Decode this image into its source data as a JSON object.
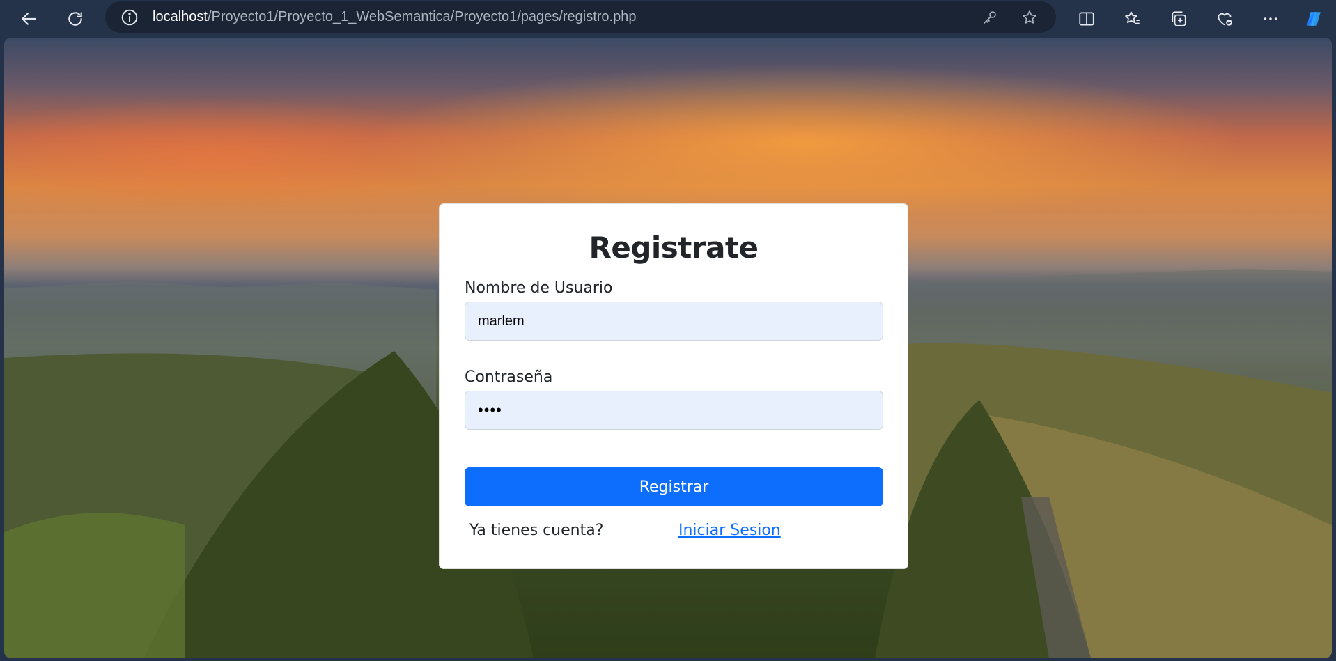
{
  "browser": {
    "url_host": "localhost",
    "url_path": "/Proyecto1/Proyecto_1_WebSemantica/Proyecto1/pages/registro.php",
    "icons": [
      "back-icon",
      "refresh-icon",
      "info-icon",
      "key-icon",
      "star-icon",
      "split-screen-icon",
      "favorites-icon",
      "collections-icon",
      "browser-essentials-icon",
      "more-icon",
      "copilot-icon"
    ]
  },
  "form": {
    "title": "Registrate",
    "username_label": "Nombre de Usuario",
    "username_value": "marlem",
    "password_label": "Contraseña",
    "password_value": "••••",
    "submit_label": "Registrar",
    "have_account_text": "Ya tienes cuenta?",
    "login_link": "Iniciar Sesion"
  },
  "colors": {
    "primary": "#0d6efd",
    "input_bg": "#e8f0fe",
    "chrome_bg": "#243349"
  }
}
